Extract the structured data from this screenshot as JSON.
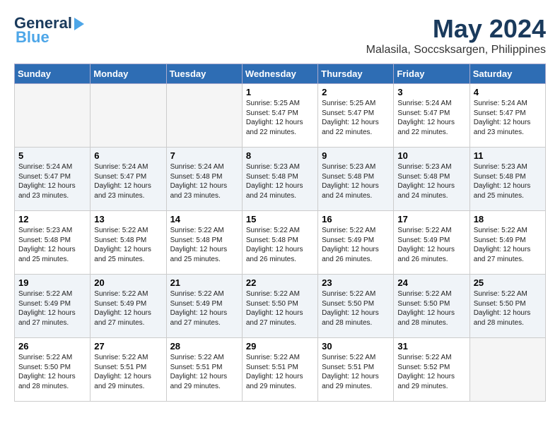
{
  "header": {
    "logo_general": "General",
    "logo_blue": "Blue",
    "month_title": "May 2024",
    "subtitle": "Malasila, Soccsksargen, Philippines"
  },
  "weekdays": [
    "Sunday",
    "Monday",
    "Tuesday",
    "Wednesday",
    "Thursday",
    "Friday",
    "Saturday"
  ],
  "weeks": [
    [
      {
        "day": "",
        "info": ""
      },
      {
        "day": "",
        "info": ""
      },
      {
        "day": "",
        "info": ""
      },
      {
        "day": "1",
        "info": "Sunrise: 5:25 AM\nSunset: 5:47 PM\nDaylight: 12 hours\nand 22 minutes."
      },
      {
        "day": "2",
        "info": "Sunrise: 5:25 AM\nSunset: 5:47 PM\nDaylight: 12 hours\nand 22 minutes."
      },
      {
        "day": "3",
        "info": "Sunrise: 5:24 AM\nSunset: 5:47 PM\nDaylight: 12 hours\nand 22 minutes."
      },
      {
        "day": "4",
        "info": "Sunrise: 5:24 AM\nSunset: 5:47 PM\nDaylight: 12 hours\nand 23 minutes."
      }
    ],
    [
      {
        "day": "5",
        "info": "Sunrise: 5:24 AM\nSunset: 5:47 PM\nDaylight: 12 hours\nand 23 minutes."
      },
      {
        "day": "6",
        "info": "Sunrise: 5:24 AM\nSunset: 5:47 PM\nDaylight: 12 hours\nand 23 minutes."
      },
      {
        "day": "7",
        "info": "Sunrise: 5:24 AM\nSunset: 5:48 PM\nDaylight: 12 hours\nand 23 minutes."
      },
      {
        "day": "8",
        "info": "Sunrise: 5:23 AM\nSunset: 5:48 PM\nDaylight: 12 hours\nand 24 minutes."
      },
      {
        "day": "9",
        "info": "Sunrise: 5:23 AM\nSunset: 5:48 PM\nDaylight: 12 hours\nand 24 minutes."
      },
      {
        "day": "10",
        "info": "Sunrise: 5:23 AM\nSunset: 5:48 PM\nDaylight: 12 hours\nand 24 minutes."
      },
      {
        "day": "11",
        "info": "Sunrise: 5:23 AM\nSunset: 5:48 PM\nDaylight: 12 hours\nand 25 minutes."
      }
    ],
    [
      {
        "day": "12",
        "info": "Sunrise: 5:23 AM\nSunset: 5:48 PM\nDaylight: 12 hours\nand 25 minutes."
      },
      {
        "day": "13",
        "info": "Sunrise: 5:22 AM\nSunset: 5:48 PM\nDaylight: 12 hours\nand 25 minutes."
      },
      {
        "day": "14",
        "info": "Sunrise: 5:22 AM\nSunset: 5:48 PM\nDaylight: 12 hours\nand 25 minutes."
      },
      {
        "day": "15",
        "info": "Sunrise: 5:22 AM\nSunset: 5:48 PM\nDaylight: 12 hours\nand 26 minutes."
      },
      {
        "day": "16",
        "info": "Sunrise: 5:22 AM\nSunset: 5:49 PM\nDaylight: 12 hours\nand 26 minutes."
      },
      {
        "day": "17",
        "info": "Sunrise: 5:22 AM\nSunset: 5:49 PM\nDaylight: 12 hours\nand 26 minutes."
      },
      {
        "day": "18",
        "info": "Sunrise: 5:22 AM\nSunset: 5:49 PM\nDaylight: 12 hours\nand 27 minutes."
      }
    ],
    [
      {
        "day": "19",
        "info": "Sunrise: 5:22 AM\nSunset: 5:49 PM\nDaylight: 12 hours\nand 27 minutes."
      },
      {
        "day": "20",
        "info": "Sunrise: 5:22 AM\nSunset: 5:49 PM\nDaylight: 12 hours\nand 27 minutes."
      },
      {
        "day": "21",
        "info": "Sunrise: 5:22 AM\nSunset: 5:49 PM\nDaylight: 12 hours\nand 27 minutes."
      },
      {
        "day": "22",
        "info": "Sunrise: 5:22 AM\nSunset: 5:50 PM\nDaylight: 12 hours\nand 27 minutes."
      },
      {
        "day": "23",
        "info": "Sunrise: 5:22 AM\nSunset: 5:50 PM\nDaylight: 12 hours\nand 28 minutes."
      },
      {
        "day": "24",
        "info": "Sunrise: 5:22 AM\nSunset: 5:50 PM\nDaylight: 12 hours\nand 28 minutes."
      },
      {
        "day": "25",
        "info": "Sunrise: 5:22 AM\nSunset: 5:50 PM\nDaylight: 12 hours\nand 28 minutes."
      }
    ],
    [
      {
        "day": "26",
        "info": "Sunrise: 5:22 AM\nSunset: 5:50 PM\nDaylight: 12 hours\nand 28 minutes."
      },
      {
        "day": "27",
        "info": "Sunrise: 5:22 AM\nSunset: 5:51 PM\nDaylight: 12 hours\nand 29 minutes."
      },
      {
        "day": "28",
        "info": "Sunrise: 5:22 AM\nSunset: 5:51 PM\nDaylight: 12 hours\nand 29 minutes."
      },
      {
        "day": "29",
        "info": "Sunrise: 5:22 AM\nSunset: 5:51 PM\nDaylight: 12 hours\nand 29 minutes."
      },
      {
        "day": "30",
        "info": "Sunrise: 5:22 AM\nSunset: 5:51 PM\nDaylight: 12 hours\nand 29 minutes."
      },
      {
        "day": "31",
        "info": "Sunrise: 5:22 AM\nSunset: 5:52 PM\nDaylight: 12 hours\nand 29 minutes."
      },
      {
        "day": "",
        "info": ""
      }
    ]
  ]
}
